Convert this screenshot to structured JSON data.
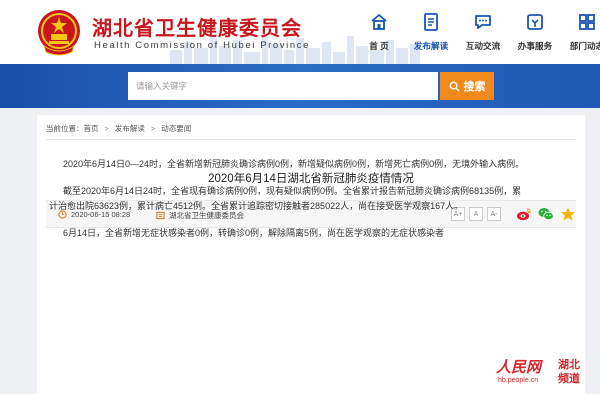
{
  "header": {
    "title": "湖北省卫生健康委员会",
    "subtitle": "Health Commission of Hubei Province"
  },
  "nav": {
    "items": [
      {
        "label": "首 页",
        "icon": "home-icon"
      },
      {
        "label": "发布解读",
        "icon": "document-icon",
        "active": true
      },
      {
        "label": "互动交流",
        "icon": "chat-icon"
      },
      {
        "label": "办事服务",
        "icon": "service-icon"
      },
      {
        "label": "部门动态",
        "icon": "grid-icon"
      }
    ]
  },
  "search": {
    "placeholder": "请输入关键字",
    "button_label": "搜索"
  },
  "breadcrumb": {
    "prefix": "当前位置：",
    "items": [
      "首页",
      "发布解读",
      "动态要闻"
    ]
  },
  "article": {
    "title": "2020年6月14日湖北省新冠肺炎疫情情况",
    "date": "2020-06-15 08:28",
    "source": "湖北省卫生健康委员会",
    "font_buttons": [
      "A+",
      "A",
      "A-"
    ],
    "paragraphs": [
      "2020年6月14日0—24时，全省新增新冠肺炎确诊病例0例，新增疑似病例0例，新增死亡病例0例，无境外输入病例。",
      "截至2020年6月14日24时，全省现有确诊病例0例，现有疑似病例0例。全省累计报告新冠肺炎确诊病例68135例，累计治愈出院63623例，累计病亡4512例。全省累计追踪密切接触者285022人，尚在接受医学观察167人。",
      "6月14日，全省新增无症状感染者0例，转确诊0例，解除隔离5例，尚在医学观察的无症状感染者"
    ]
  },
  "share": {
    "icons": [
      "weibo-icon",
      "wechat-icon",
      "favorite-icon"
    ]
  },
  "watermark": {
    "brand": "人民网",
    "region": "湖北",
    "channel": "频道",
    "url": "hb.people.cn"
  },
  "colors": {
    "title_red": "#c8161d",
    "nav_blue": "#1a56b0",
    "band_blue": "#1f5fb8",
    "search_orange": "#f08a1b"
  }
}
